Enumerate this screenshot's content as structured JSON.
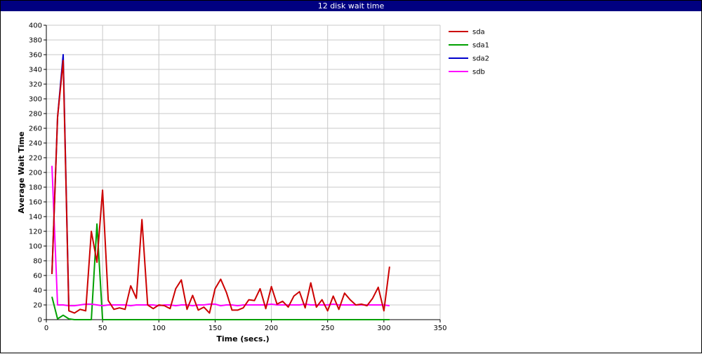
{
  "window": {
    "title": "12 disk wait time"
  },
  "chart_data": {
    "type": "line",
    "title": "12 disk wait time",
    "xlabel": "Time (secs.)",
    "ylabel": "Average Wait Time",
    "xlim": [
      0,
      350
    ],
    "ylim": [
      0,
      400
    ],
    "xticks": [
      0,
      50,
      100,
      150,
      200,
      250,
      300,
      350
    ],
    "yticks": [
      0,
      20,
      40,
      60,
      80,
      100,
      120,
      140,
      160,
      180,
      200,
      220,
      240,
      260,
      280,
      300,
      320,
      340,
      360,
      380,
      400
    ],
    "grid": true,
    "legend_position": "right",
    "series": [
      {
        "name": "sda2",
        "color": "#0000cc",
        "x": [
          5,
          10,
          15,
          20
        ],
        "y": [
          62,
          275,
          360,
          12
        ]
      },
      {
        "name": "sda1",
        "color": "#00a000",
        "x": [
          5,
          10,
          15,
          20,
          25,
          30,
          35,
          40,
          45,
          50,
          55,
          60,
          70,
          80,
          90,
          100,
          110,
          120,
          130,
          140,
          150,
          160,
          170,
          180,
          190,
          200,
          210,
          220,
          230,
          240,
          250,
          260,
          270,
          280,
          290,
          300,
          305
        ],
        "y": [
          31,
          1,
          6,
          1,
          0,
          0,
          0,
          0,
          130,
          0,
          0,
          0,
          0,
          0,
          0,
          0,
          0,
          0,
          0,
          0,
          0,
          0,
          0,
          0,
          0,
          0,
          0,
          0,
          0,
          0,
          0,
          0,
          0,
          0,
          0,
          0,
          0
        ]
      },
      {
        "name": "sdb",
        "color": "#ff00ff",
        "x": [
          5,
          10,
          15,
          20,
          25,
          30,
          35,
          40,
          45,
          50,
          55,
          60,
          65,
          70,
          75,
          80,
          85,
          90,
          95,
          100,
          105,
          110,
          115,
          120,
          125,
          130,
          135,
          140,
          145,
          150,
          155,
          160,
          165,
          170,
          175,
          180,
          185,
          190,
          195,
          200,
          205,
          210,
          215,
          220,
          225,
          230,
          235,
          240,
          245,
          250,
          255,
          260,
          265,
          270,
          275,
          280,
          285,
          290,
          295,
          300,
          305
        ],
        "y": [
          209,
          20,
          20,
          19,
          19,
          20,
          21,
          21,
          20,
          19,
          20,
          20,
          20,
          20,
          19,
          20,
          20,
          20,
          20,
          19,
          20,
          20,
          19,
          20,
          20,
          19,
          20,
          20,
          21,
          21,
          19,
          20,
          20,
          19,
          20,
          20,
          20,
          20,
          20,
          21,
          20,
          20,
          20,
          20,
          20,
          21,
          20,
          20,
          20,
          20,
          21,
          20,
          20,
          20,
          20,
          20,
          20,
          20,
          20,
          20,
          19
        ]
      },
      {
        "name": "sda",
        "color": "#cc0000",
        "x": [
          5,
          10,
          15,
          20,
          25,
          30,
          35,
          40,
          45,
          50,
          55,
          60,
          65,
          70,
          75,
          80,
          85,
          90,
          95,
          100,
          105,
          110,
          115,
          120,
          125,
          130,
          135,
          140,
          145,
          150,
          155,
          160,
          165,
          170,
          175,
          180,
          185,
          190,
          195,
          200,
          205,
          210,
          215,
          220,
          225,
          230,
          235,
          240,
          245,
          250,
          255,
          260,
          265,
          270,
          275,
          280,
          285,
          290,
          295,
          300,
          305
        ],
        "y": [
          62,
          275,
          352,
          12,
          9,
          14,
          12,
          120,
          78,
          176,
          26,
          14,
          16,
          14,
          46,
          29,
          136,
          20,
          15,
          20,
          19,
          15,
          42,
          54,
          14,
          33,
          13,
          17,
          9,
          42,
          55,
          37,
          13,
          13,
          16,
          27,
          26,
          42,
          15,
          45,
          21,
          25,
          17,
          32,
          38,
          16,
          50,
          17,
          27,
          12,
          32,
          14,
          36,
          27,
          20,
          21,
          19,
          29,
          44,
          12,
          72
        ]
      }
    ],
    "legend": [
      "sda",
      "sda1",
      "sda2",
      "sdb"
    ]
  }
}
